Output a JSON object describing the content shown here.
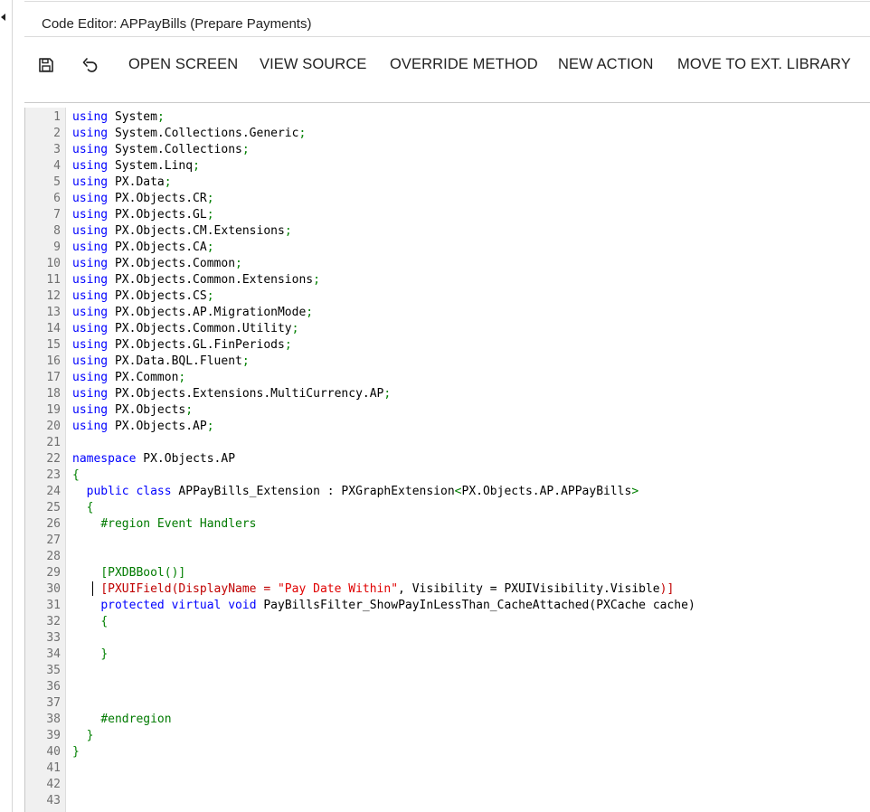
{
  "window": {
    "title": "Code Editor: APPayBills (Prepare Payments)"
  },
  "toolbar": {
    "save_icon": "floppy-disk-icon",
    "undo_icon": "undo-icon",
    "buttons": [
      {
        "label": "OPEN SCREEN"
      },
      {
        "label": "VIEW SOURCE"
      },
      {
        "label": "OVERRIDE METHOD"
      },
      {
        "label": "NEW ACTION"
      },
      {
        "label": "MOVE TO EXT. LIBRARY"
      }
    ]
  },
  "colors": {
    "keyword": "#0000ff",
    "punctuation": "#008000",
    "attribute": "#c00000",
    "string": "#e00000",
    "preprocessor": "#007a00",
    "line_number": "#707070"
  },
  "editor": {
    "lines": [
      [
        [
          "kw",
          "using"
        ],
        [
          "pl",
          " System"
        ],
        [
          "gr",
          ";"
        ]
      ],
      [
        [
          "kw",
          "using"
        ],
        [
          "pl",
          " System.Collections.Generic"
        ],
        [
          "gr",
          ";"
        ]
      ],
      [
        [
          "kw",
          "using"
        ],
        [
          "pl",
          " System.Collections"
        ],
        [
          "gr",
          ";"
        ]
      ],
      [
        [
          "kw",
          "using"
        ],
        [
          "pl",
          " System.Linq"
        ],
        [
          "gr",
          ";"
        ]
      ],
      [
        [
          "kw",
          "using"
        ],
        [
          "pl",
          " PX.Data"
        ],
        [
          "gr",
          ";"
        ]
      ],
      [
        [
          "kw",
          "using"
        ],
        [
          "pl",
          " PX.Objects.CR"
        ],
        [
          "gr",
          ";"
        ]
      ],
      [
        [
          "kw",
          "using"
        ],
        [
          "pl",
          " PX.Objects.GL"
        ],
        [
          "gr",
          ";"
        ]
      ],
      [
        [
          "kw",
          "using"
        ],
        [
          "pl",
          " PX.Objects.CM.Extensions"
        ],
        [
          "gr",
          ";"
        ]
      ],
      [
        [
          "kw",
          "using"
        ],
        [
          "pl",
          " PX.Objects.CA"
        ],
        [
          "gr",
          ";"
        ]
      ],
      [
        [
          "kw",
          "using"
        ],
        [
          "pl",
          " PX.Objects.Common"
        ],
        [
          "gr",
          ";"
        ]
      ],
      [
        [
          "kw",
          "using"
        ],
        [
          "pl",
          " PX.Objects.Common.Extensions"
        ],
        [
          "gr",
          ";"
        ]
      ],
      [
        [
          "kw",
          "using"
        ],
        [
          "pl",
          " PX.Objects.CS"
        ],
        [
          "gr",
          ";"
        ]
      ],
      [
        [
          "kw",
          "using"
        ],
        [
          "pl",
          " PX.Objects.AP.MigrationMode"
        ],
        [
          "gr",
          ";"
        ]
      ],
      [
        [
          "kw",
          "using"
        ],
        [
          "pl",
          " PX.Objects.Common.Utility"
        ],
        [
          "gr",
          ";"
        ]
      ],
      [
        [
          "kw",
          "using"
        ],
        [
          "pl",
          " PX.Objects.GL.FinPeriods"
        ],
        [
          "gr",
          ";"
        ]
      ],
      [
        [
          "kw",
          "using"
        ],
        [
          "pl",
          " PX.Data.BQL.Fluent"
        ],
        [
          "gr",
          ";"
        ]
      ],
      [
        [
          "kw",
          "using"
        ],
        [
          "pl",
          " PX.Common"
        ],
        [
          "gr",
          ";"
        ]
      ],
      [
        [
          "kw",
          "using"
        ],
        [
          "pl",
          " PX.Objects.Extensions.MultiCurrency.AP"
        ],
        [
          "gr",
          ";"
        ]
      ],
      [
        [
          "kw",
          "using"
        ],
        [
          "pl",
          " PX.Objects"
        ],
        [
          "gr",
          ";"
        ]
      ],
      [
        [
          "kw",
          "using"
        ],
        [
          "pl",
          " PX.Objects.AP"
        ],
        [
          "gr",
          ";"
        ]
      ],
      [],
      [
        [
          "kw",
          "namespace"
        ],
        [
          "pl",
          " PX.Objects.AP"
        ]
      ],
      [
        [
          "gr",
          "{"
        ]
      ],
      [
        [
          "pl",
          "  "
        ],
        [
          "kw",
          "public"
        ],
        [
          "pl",
          " "
        ],
        [
          "kw",
          "class"
        ],
        [
          "pl",
          " APPayBills_Extension : PXGraphExtension"
        ],
        [
          "gr",
          "<"
        ],
        [
          "pl",
          "PX.Objects.AP.APPayBills"
        ],
        [
          "gr",
          ">"
        ]
      ],
      [
        [
          "pl",
          "  "
        ],
        [
          "gr",
          "{"
        ]
      ],
      [
        [
          "pl",
          "    "
        ],
        [
          "pr",
          "#region Event Handlers"
        ]
      ],
      [],
      [],
      [
        [
          "pl",
          "    "
        ],
        [
          "gr",
          "["
        ],
        [
          "pr",
          "PXDBBool"
        ],
        [
          "gr",
          "()]"
        ]
      ],
      [
        [
          "pl",
          "    "
        ],
        [
          "at",
          "[PXUIField(DisplayName = "
        ],
        [
          "st",
          "\"Pay Date Within\""
        ],
        [
          "pl",
          ", Visibility = PXUIVisibility.Visible"
        ],
        [
          "at",
          ")]"
        ]
      ],
      [
        [
          "pl",
          "    "
        ],
        [
          "kw",
          "protected"
        ],
        [
          "pl",
          " "
        ],
        [
          "kw",
          "virtual"
        ],
        [
          "pl",
          " "
        ],
        [
          "kw",
          "void"
        ],
        [
          "pl",
          " PayBillsFilter_ShowPayInLessThan_CacheAttached(PXCache cache)"
        ]
      ],
      [
        [
          "pl",
          "    "
        ],
        [
          "gr",
          "{"
        ]
      ],
      [],
      [
        [
          "pl",
          "    "
        ],
        [
          "gr",
          "}"
        ]
      ],
      [],
      [],
      [],
      [
        [
          "pl",
          "    "
        ],
        [
          "pr",
          "#endregion"
        ]
      ],
      [
        [
          "pl",
          "  "
        ],
        [
          "gr",
          "}"
        ]
      ],
      [
        [
          "gr",
          "}"
        ]
      ],
      [],
      [],
      []
    ]
  }
}
